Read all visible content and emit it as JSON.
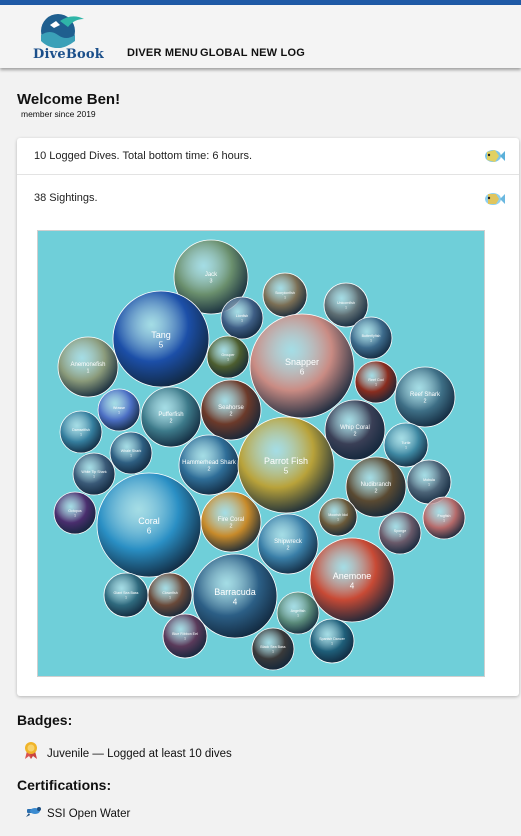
{
  "header": {
    "logo_text": "DiveBook",
    "nav": [
      "DIVER MENU",
      "GLOBAL",
      "NEW LOG"
    ]
  },
  "welcome": {
    "title": "Welcome Ben!",
    "subtitle": "member since 2019"
  },
  "stats": {
    "dives_text": "10 Logged Dives. Total bottom time: 6 hours.",
    "sightings_text": "38 Sightings."
  },
  "sightings": [
    {
      "name": "Jack",
      "count": 3,
      "color": "#6a8f6d"
    },
    {
      "name": "Scorpionfish",
      "count": 1,
      "color": "#7b6f55"
    },
    {
      "name": "Lionfish",
      "count": 1,
      "color": "#3f5f86"
    },
    {
      "name": "Unicornfish",
      "count": 1,
      "color": "#5f6f74"
    },
    {
      "name": "Tang",
      "count": 5,
      "color": "#1c4fa8"
    },
    {
      "name": "Anemonefish",
      "count": 1,
      "color": "#8a9a7a"
    },
    {
      "name": "Butterflyfish",
      "count": 1,
      "color": "#3d6b8c"
    },
    {
      "name": "Grouper",
      "count": 1,
      "color": "#4d5e2f"
    },
    {
      "name": "Snapper",
      "count": 6,
      "color": "#c98b83"
    },
    {
      "name": "Reef Cod",
      "count": 1,
      "color": "#8a2d1f"
    },
    {
      "name": "Reef Shark",
      "count": 2,
      "color": "#3e6f86"
    },
    {
      "name": "Wrasse",
      "count": 1,
      "color": "#4c6fc4"
    },
    {
      "name": "Pufferfish",
      "count": 2,
      "color": "#3d7a8a"
    },
    {
      "name": "Seahorse",
      "count": 2,
      "color": "#6c3a2a"
    },
    {
      "name": "Whip Coral",
      "count": 2,
      "color": "#3a3f56"
    },
    {
      "name": "Turtle",
      "count": 1,
      "color": "#3e88a2"
    },
    {
      "name": "Damselfish",
      "count": 1,
      "color": "#357e9e"
    },
    {
      "name": "Whale Shark",
      "count": 1,
      "color": "#2e5f82"
    },
    {
      "name": "Hammerhead Shark",
      "count": 2,
      "color": "#2f6e98"
    },
    {
      "name": "Parrot Fish",
      "count": 5,
      "color": "#b8a23a"
    },
    {
      "name": "Nudibranch",
      "count": 2,
      "color": "#5a4a32"
    },
    {
      "name": "Mobula",
      "count": 1,
      "color": "#4c6478"
    },
    {
      "name": "White Tip Shark",
      "count": 1,
      "color": "#3a5a78"
    },
    {
      "name": "Octopus",
      "count": 1,
      "color": "#4a2e6e"
    },
    {
      "name": "Coral",
      "count": 6,
      "color": "#2a8fc4"
    },
    {
      "name": "Fire Coral",
      "count": 2,
      "color": "#c78a2a"
    },
    {
      "name": "Moorish Idol",
      "count": 1,
      "color": "#6b5a3a"
    },
    {
      "name": "Frogfish",
      "count": 1,
      "color": "#b56a6a"
    },
    {
      "name": "Sponge",
      "count": 1,
      "color": "#6a5a6a"
    },
    {
      "name": "Shipwreck",
      "count": 2,
      "color": "#3a7fa8"
    },
    {
      "name": "Anemone",
      "count": 4,
      "color": "#c84a35"
    },
    {
      "name": "Giant Sea Bass",
      "count": 1,
      "color": "#2f6a7e"
    },
    {
      "name": "Clownfish",
      "count": 1,
      "color": "#6a4a3a"
    },
    {
      "name": "Barracuda",
      "count": 4,
      "color": "#2c5f86"
    },
    {
      "name": "Angelfish",
      "count": 1,
      "color": "#5a8a7a"
    },
    {
      "name": "Blue Ribbon Eel",
      "count": 1,
      "color": "#5a3a5a"
    },
    {
      "name": "Black Sea Bass",
      "count": 1,
      "color": "#3a3a3a"
    },
    {
      "name": "Spanish Dancer",
      "count": 1,
      "color": "#1f5f7a"
    }
  ],
  "badges": {
    "title": "Badges:",
    "items": [
      {
        "label": "Juvenile — Logged at least 10 dives",
        "icon": "medal-icon"
      }
    ]
  },
  "certifications": {
    "title": "Certifications:",
    "items": [
      {
        "label": "SSI Open Water",
        "icon": "diver-icon"
      }
    ]
  },
  "colors": {
    "accent": "#1f5aa6",
    "panel": "#6fcfd9"
  }
}
